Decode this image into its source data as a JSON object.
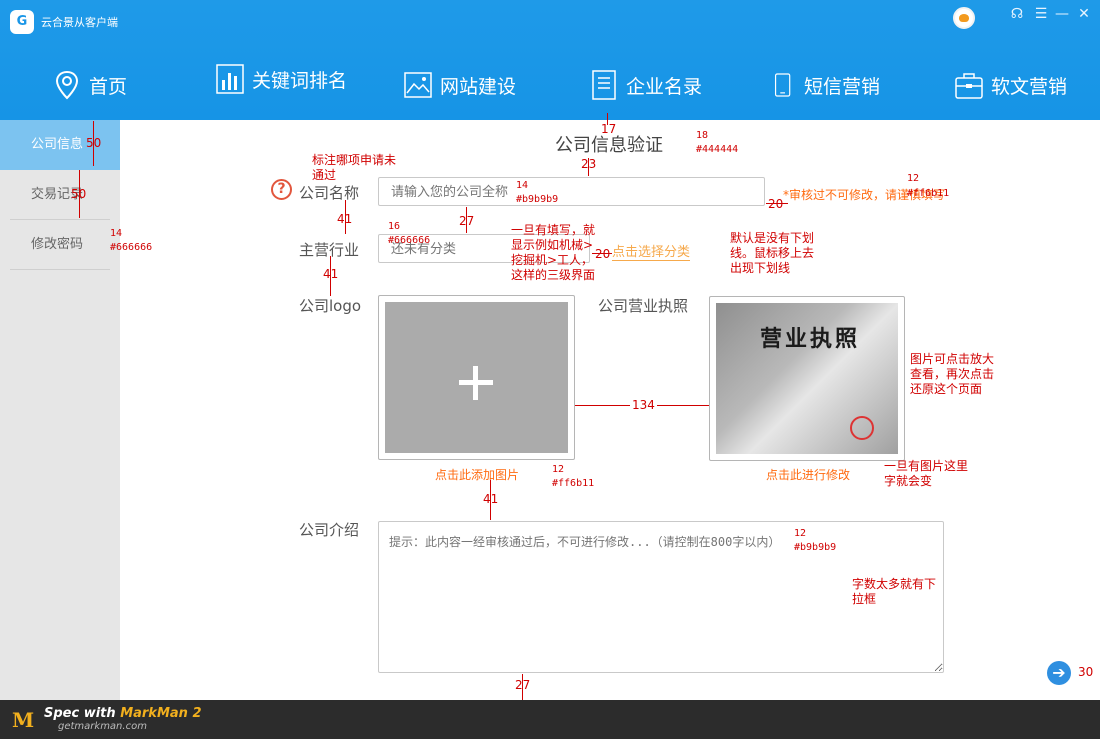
{
  "app": {
    "title": "云合景从客户端",
    "logo": "G"
  },
  "window": {
    "headset": "☊",
    "menu": "☰",
    "minimize": "—",
    "close": "✕"
  },
  "nav": [
    {
      "label": "首页",
      "icon": "location-pin-icon"
    },
    {
      "label": "关键词排名",
      "icon": "bar-chart-icon"
    },
    {
      "label": "网站建设",
      "icon": "image-icon"
    },
    {
      "label": "企业名录",
      "icon": "book-icon"
    },
    {
      "label": "短信营销",
      "icon": "phone-icon"
    },
    {
      "label": "软文营销",
      "icon": "briefcase-icon"
    }
  ],
  "sidebar": [
    {
      "label": "公司信息",
      "active": true
    },
    {
      "label": "交易记录"
    },
    {
      "label": "修改密码"
    }
  ],
  "form": {
    "title": "公司信息验证",
    "required_mark": "?",
    "company_name_label": "公司名称",
    "company_name_placeholder": "请输入您的公司全称",
    "company_name_note": "*审核过不可修改，请谨慎填写",
    "industry_label": "主营行业",
    "industry_placeholder": "还未有分类",
    "industry_link": "点击选择分类",
    "logo_label": "公司logo",
    "logo_caption": "点击此添加图片",
    "license_label": "公司营业执照",
    "license_title": "营业执照",
    "license_caption": "点击此进行修改",
    "intro_label": "公司介绍",
    "intro_placeholder": "提示：此内容一经审核通过后，不可进行修改...（请控制在800字以内）"
  },
  "annotations": {
    "a50_1": "50",
    "a50_2": "50",
    "a14_side": "14",
    "c_666_side": "#666666",
    "a17": "17",
    "a18": "18",
    "c_444": "#444444",
    "a23": "23",
    "note_required": "标注哪项申请未\n通过",
    "a14_input": "14",
    "c_b9_input": "#b9b9b9",
    "a12_note": "12",
    "c_ff_note": "#ff6b11",
    "a20_1": "20",
    "a41_1": "41",
    "a27_1": "27",
    "a16": "16",
    "c_666_ind": "#666666",
    "note_industry": "一旦有填写，就\n显示例如机械>\n挖掘机>工人，\n这样的三级界面",
    "a20_2": "20",
    "note_underline": "默认是没有下划\n线。鼠标移上去\n出现下划线",
    "a41_2": "41",
    "a134": "134",
    "note_zoom": "图片可点击放大\n查看，再次点击\n还原这个页面",
    "a12_caption": "12",
    "c_ff_caption": "#ff6b11",
    "note_change": "一旦有图片这里\n字就会变",
    "a41_3": "41",
    "a12_intro": "12",
    "c_b9_intro": "#b9b9b9",
    "note_scroll": "字数太多就有下\n拉框",
    "a27_2": "27",
    "a30": "30"
  },
  "footer": {
    "logo": "M",
    "spec": "Spec with ",
    "brand": "MarkMan 2",
    "url": "getmarkman.com"
  },
  "colors": {
    "header": "#1694e6",
    "sidebar_active": "#7cc3f0",
    "annotation": "#d00000",
    "orange": "#ff6b11"
  }
}
